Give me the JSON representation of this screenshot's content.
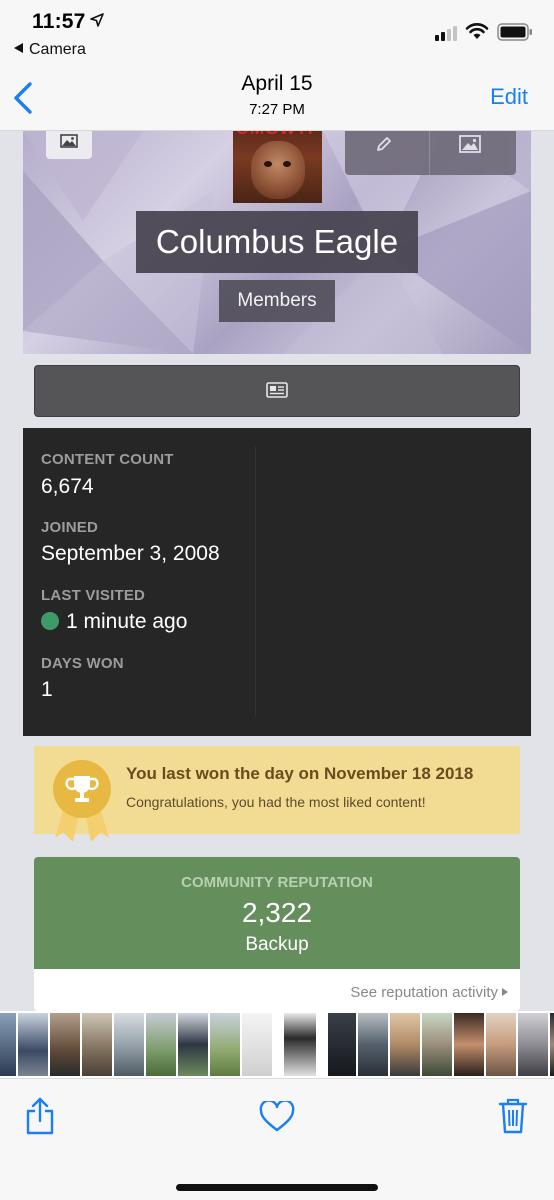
{
  "status_bar": {
    "time": "11:57",
    "back_app": "Camera"
  },
  "nav": {
    "date": "April 15",
    "time": "7:27 PM",
    "edit_label": "Edit"
  },
  "profile": {
    "avatar_text": "OMGWTF",
    "name": "Columbus Eagle",
    "group": "Members"
  },
  "stats": [
    {
      "label": "CONTENT COUNT",
      "value": "6,674"
    },
    {
      "label": "JOINED",
      "value": "September 3, 2008"
    },
    {
      "label": "LAST VISITED",
      "value": "1 minute ago"
    },
    {
      "label": "DAYS WON",
      "value": "1"
    }
  ],
  "day_won": {
    "title": "You last won the day on November 18 2018",
    "subtitle": "Congratulations, you had the most liked content!"
  },
  "reputation": {
    "label": "COMMUNITY REPUTATION",
    "value": "2,322",
    "level": "Backup",
    "link": "See reputation activity"
  },
  "colors": {
    "accent": "#1a7ef5",
    "online": "#3f9a6a",
    "reputation": "#648f5c",
    "day_won_bg": "#f2dc94"
  },
  "icons": {
    "location": "location-arrow-icon",
    "back": "chevron-left-icon",
    "share": "share-icon",
    "favorite": "heart-icon",
    "delete": "trash-icon"
  }
}
